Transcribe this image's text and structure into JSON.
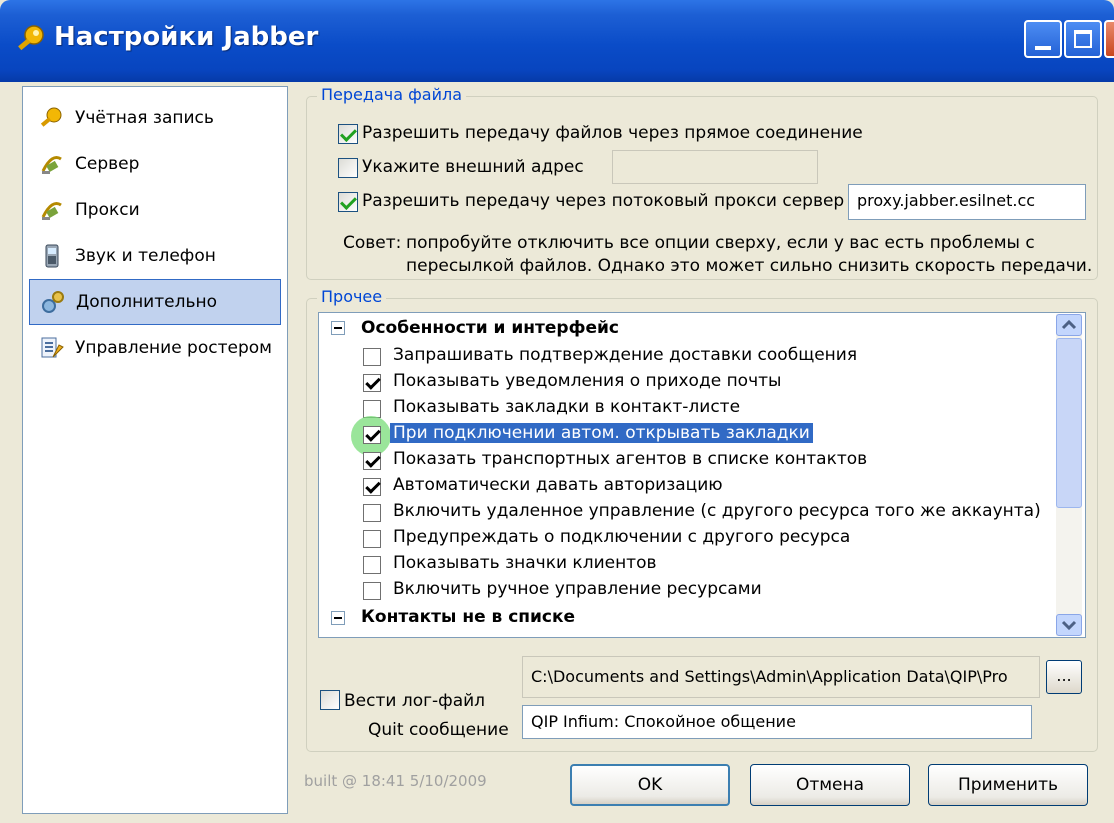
{
  "window": {
    "title": "Настройки Jabber",
    "title_color": "#0a4cc8"
  },
  "sidebar": {
    "items": [
      {
        "label": "Учётная запись",
        "icon": "key-icon",
        "selected": false
      },
      {
        "label": "Сервер",
        "icon": "satellite-icon",
        "selected": false
      },
      {
        "label": "Прокси",
        "icon": "satellite-icon",
        "selected": false
      },
      {
        "label": "Звук и телефон",
        "icon": "phone-icon",
        "selected": false
      },
      {
        "label": "Дополнительно",
        "icon": "gear-icon",
        "selected": true
      },
      {
        "label": "Управление ростером",
        "icon": "roster-icon",
        "selected": false
      }
    ]
  },
  "file_transfer": {
    "legend": "Передача файла",
    "direct_label": "Разрешить передачу файлов через прямое соединение",
    "direct_checked": true,
    "external_label": "Укажите внешний адрес",
    "external_checked": false,
    "external_value": "",
    "proxy_label": "Разрешить передачу через потоковый прокси сервер",
    "proxy_checked": true,
    "proxy_value": "proxy.jabber.esilnet.cc",
    "tip_prefix": "Совет:",
    "tip_line1": "попробуйте отключить все опции сверху, если у вас есть проблемы с",
    "tip_line2": "пересылкой файлов. Однако это может сильно снизить скорость передачи."
  },
  "misc": {
    "legend": "Прочее",
    "section1": "Особенности и интерфейс",
    "options": [
      {
        "label": "Запрашивать подтверждение доставки сообщения",
        "checked": false,
        "selected": false
      },
      {
        "label": "Показывать уведомления о приходе почты",
        "checked": true,
        "selected": false
      },
      {
        "label": "Показывать закладки в контакт-листе",
        "checked": false,
        "selected": false
      },
      {
        "label": "При подключении автом. открывать закладки",
        "checked": true,
        "selected": true
      },
      {
        "label": "Показать транспортных агентов в списке контактов",
        "checked": true,
        "selected": false
      },
      {
        "label": "Автоматически давать авторизацию",
        "checked": true,
        "selected": false
      },
      {
        "label": "Включить удаленное управление (с другого ресурса того же аккаунта)",
        "checked": false,
        "selected": false
      },
      {
        "label": "Предупреждать о подключении с другого ресурса",
        "checked": false,
        "selected": false
      },
      {
        "label": "Показывать значки клиентов",
        "checked": false,
        "selected": false
      },
      {
        "label": "Включить ручное управление ресурсами",
        "checked": false,
        "selected": false
      }
    ],
    "section2": "Контакты не в списке",
    "log_label": "Вести лог-файл",
    "log_checked": false,
    "log_path": "C:\\Documents and Settings\\Admin\\Application Data\\QIP\\Pro",
    "browse_label": "...",
    "quit_label": "Quit сообщение",
    "quit_value": "QIP Infium: Спокойное общение"
  },
  "footer": {
    "built": "built @ 18:41 5/10/2009",
    "ok": "OK",
    "cancel": "Отмена",
    "apply": "Применить"
  }
}
